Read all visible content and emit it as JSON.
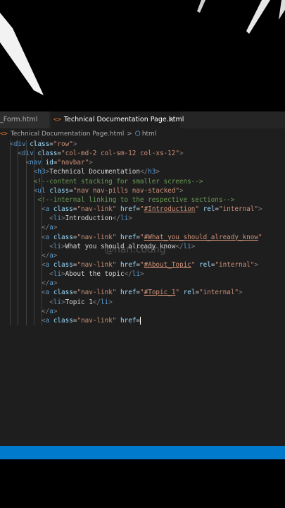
{
  "tabs": [
    {
      "label": "_Form.html",
      "active": false
    },
    {
      "label": "Technical Documentation Page.html",
      "active": true,
      "icon": "html-icon"
    }
  ],
  "tab_close": "×",
  "breadcrumb": {
    "file": "Technical Documentation Page.html",
    "node": "html",
    "separator": ">"
  },
  "watermark": "@han.codng",
  "code_lines": [
    {
      "indent": 2,
      "tokens": [
        [
          "br",
          "<"
        ],
        [
          "tag",
          "div"
        ],
        [
          "tx",
          " "
        ],
        [
          "at",
          "class"
        ],
        [
          "tx",
          "="
        ],
        [
          "str",
          "\"row\""
        ],
        [
          "br",
          ">"
        ]
      ]
    },
    {
      "indent": 4,
      "tokens": [
        [
          "br",
          "<"
        ],
        [
          "tag",
          "div"
        ],
        [
          "tx",
          " "
        ],
        [
          "at",
          "class"
        ],
        [
          "tx",
          "="
        ],
        [
          "str",
          "\"col-md-2 col-sm-12 col-xs-12\""
        ],
        [
          "br",
          ">"
        ]
      ]
    },
    {
      "indent": 6,
      "tokens": [
        [
          "br",
          "<"
        ],
        [
          "tag",
          "nav"
        ],
        [
          "tx",
          " "
        ],
        [
          "at",
          "id"
        ],
        [
          "tx",
          "="
        ],
        [
          "str",
          "\"navbar\""
        ],
        [
          "br",
          ">"
        ]
      ]
    },
    {
      "indent": 8,
      "tokens": [
        [
          "br",
          "<"
        ],
        [
          "tag",
          "h3"
        ],
        [
          "br",
          ">"
        ],
        [
          "tx",
          "Technical Documentation"
        ],
        [
          "br",
          "</"
        ],
        [
          "tag",
          "h3"
        ],
        [
          "br",
          ">"
        ]
      ]
    },
    {
      "indent": 8,
      "tokens": [
        [
          "cm",
          "<!--content stacking for smaller screens-->"
        ]
      ]
    },
    {
      "indent": 8,
      "tokens": [
        [
          "br",
          "<"
        ],
        [
          "tag",
          "ul"
        ],
        [
          "tx",
          " "
        ],
        [
          "at",
          "class"
        ],
        [
          "tx",
          "="
        ],
        [
          "str",
          "\"nav nav-pills nav-stacked\""
        ],
        [
          "br",
          ">"
        ]
      ]
    },
    {
      "indent": 8,
      "tokens": [
        [
          "cm",
          " <!--internal linking to the respective sections-->"
        ]
      ]
    },
    {
      "indent": 10,
      "tokens": [
        [
          "br",
          "<"
        ],
        [
          "tag",
          "a"
        ],
        [
          "tx",
          " "
        ],
        [
          "at",
          "class"
        ],
        [
          "tx",
          "="
        ],
        [
          "str",
          "\"nav-link\""
        ],
        [
          "tx",
          " "
        ],
        [
          "at",
          "href"
        ],
        [
          "tx",
          "="
        ],
        [
          "str",
          "\""
        ],
        [
          "stru",
          "#Introduction"
        ],
        [
          "str",
          "\""
        ],
        [
          "tx",
          " "
        ],
        [
          "at",
          "rel"
        ],
        [
          "tx",
          "="
        ],
        [
          "str",
          "\"internal\""
        ],
        [
          "br",
          ">"
        ]
      ]
    },
    {
      "indent": 12,
      "tokens": [
        [
          "br",
          "<"
        ],
        [
          "tag",
          "li"
        ],
        [
          "br",
          ">"
        ],
        [
          "tx",
          "Introduction"
        ],
        [
          "br",
          "</"
        ],
        [
          "tag",
          "li"
        ],
        [
          "br",
          ">"
        ]
      ]
    },
    {
      "indent": 10,
      "tokens": [
        [
          "br",
          "</"
        ],
        [
          "tag",
          "a"
        ],
        [
          "br",
          ">"
        ]
      ]
    },
    {
      "indent": 10,
      "tokens": [
        [
          "br",
          "<"
        ],
        [
          "tag",
          "a"
        ],
        [
          "tx",
          " "
        ],
        [
          "at",
          "class"
        ],
        [
          "tx",
          "="
        ],
        [
          "str",
          "\"nav-link\""
        ],
        [
          "tx",
          " "
        ],
        [
          "at",
          "href"
        ],
        [
          "tx",
          "="
        ],
        [
          "str",
          "\""
        ],
        [
          "stru",
          "#What_you_should_already_know"
        ],
        [
          "str",
          "\""
        ]
      ]
    },
    {
      "indent": 12,
      "tokens": [
        [
          "br",
          "<"
        ],
        [
          "tag",
          "li"
        ],
        [
          "br",
          ">"
        ],
        [
          "tx",
          "What you should already know"
        ],
        [
          "br",
          "</"
        ],
        [
          "tag",
          "li"
        ],
        [
          "br",
          ">"
        ]
      ]
    },
    {
      "indent": 10,
      "tokens": [
        [
          "br",
          "</"
        ],
        [
          "tag",
          "a"
        ],
        [
          "br",
          ">"
        ]
      ]
    },
    {
      "indent": 10,
      "tokens": [
        [
          "br",
          "<"
        ],
        [
          "tag",
          "a"
        ],
        [
          "tx",
          " "
        ],
        [
          "at",
          "class"
        ],
        [
          "tx",
          "="
        ],
        [
          "str",
          "\"nav-link\""
        ],
        [
          "tx",
          " "
        ],
        [
          "at",
          "href"
        ],
        [
          "tx",
          "="
        ],
        [
          "str",
          "\""
        ],
        [
          "stru",
          "#About_Topic"
        ],
        [
          "str",
          "\""
        ],
        [
          "tx",
          " "
        ],
        [
          "at",
          "rel"
        ],
        [
          "tx",
          "="
        ],
        [
          "str",
          "\"internal\""
        ],
        [
          "br",
          ">"
        ]
      ]
    },
    {
      "indent": 12,
      "tokens": [
        [
          "br",
          "<"
        ],
        [
          "tag",
          "li"
        ],
        [
          "br",
          ">"
        ],
        [
          "tx",
          "About the topic"
        ],
        [
          "br",
          "</"
        ],
        [
          "tag",
          "li"
        ],
        [
          "br",
          ">"
        ]
      ]
    },
    {
      "indent": 10,
      "tokens": [
        [
          "br",
          "</"
        ],
        [
          "tag",
          "a"
        ],
        [
          "br",
          ">"
        ]
      ]
    },
    {
      "indent": 10,
      "tokens": [
        [
          "br",
          "<"
        ],
        [
          "tag",
          "a"
        ],
        [
          "tx",
          " "
        ],
        [
          "at",
          "class"
        ],
        [
          "tx",
          "="
        ],
        [
          "str",
          "\"nav-link\""
        ],
        [
          "tx",
          " "
        ],
        [
          "at",
          "href"
        ],
        [
          "tx",
          "="
        ],
        [
          "str",
          "\""
        ],
        [
          "stru",
          "#Topic_1"
        ],
        [
          "str",
          "\""
        ],
        [
          "tx",
          " "
        ],
        [
          "at",
          "rel"
        ],
        [
          "tx",
          "="
        ],
        [
          "str",
          "\"internal\""
        ],
        [
          "br",
          ">"
        ]
      ]
    },
    {
      "indent": 12,
      "tokens": [
        [
          "br",
          "<"
        ],
        [
          "tag",
          "li"
        ],
        [
          "br",
          ">"
        ],
        [
          "tx",
          "Topic 1"
        ],
        [
          "br",
          "</"
        ],
        [
          "tag",
          "li"
        ],
        [
          "br",
          ">"
        ]
      ]
    },
    {
      "indent": 10,
      "tokens": [
        [
          "br",
          "</"
        ],
        [
          "tag",
          "a"
        ],
        [
          "br",
          ">"
        ]
      ]
    },
    {
      "indent": 10,
      "cursor": true,
      "tokens": [
        [
          "br",
          "<"
        ],
        [
          "tag",
          "a"
        ],
        [
          "tx",
          " "
        ],
        [
          "at",
          "class"
        ],
        [
          "tx",
          "="
        ],
        [
          "str",
          "\"nav-link\""
        ],
        [
          "tx",
          " "
        ],
        [
          "at",
          "href"
        ],
        [
          "tx",
          "="
        ]
      ]
    }
  ],
  "colors": {
    "editor_bg": "#1e1e1e",
    "tag": "#569cd6",
    "attribute": "#9cdcfe",
    "string": "#ce9178",
    "comment": "#6a9955",
    "statusbar": "#007acc",
    "html_icon": "#e37933"
  }
}
